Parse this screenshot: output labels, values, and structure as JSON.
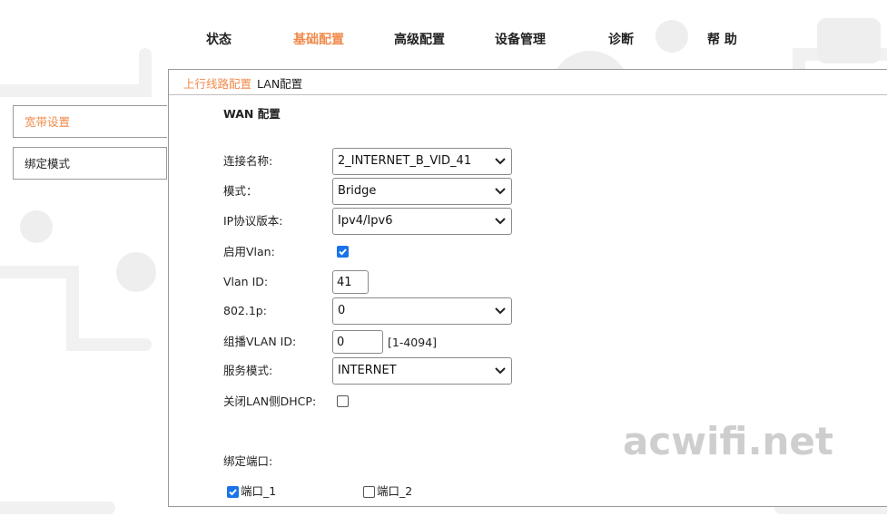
{
  "nav": {
    "items": [
      {
        "label": "状态",
        "active": false
      },
      {
        "label": "基础配置",
        "active": true
      },
      {
        "label": "高级配置",
        "active": false
      },
      {
        "label": "设备管理",
        "active": false
      },
      {
        "label": "诊断",
        "active": false
      },
      {
        "label": "帮 助",
        "active": false
      }
    ]
  },
  "sidebar": {
    "items": [
      {
        "label": "宽带设置",
        "active": true
      },
      {
        "label": "绑定模式",
        "active": false
      }
    ]
  },
  "breadcrumb": {
    "items": [
      "上行线路配置",
      "LAN配置"
    ]
  },
  "section_title": "WAN 配置",
  "form": {
    "connection_name": {
      "label": "连接名称:",
      "value": "2_INTERNET_B_VID_41"
    },
    "mode": {
      "label": "模式：",
      "value": "Bridge"
    },
    "ip_version": {
      "label": "IP协议版本:",
      "value": "Ipv4/Ipv6"
    },
    "enable_vlan": {
      "label": "启用Vlan:",
      "checked": true
    },
    "vlan_id": {
      "label": "Vlan ID:",
      "value": "41"
    },
    "dot1p": {
      "label": "802.1p:",
      "value": "0"
    },
    "multicast_vlan": {
      "label": "组播VLAN ID:",
      "value": "0",
      "hint": "[1-4094]"
    },
    "service_mode": {
      "label": "服务模式:",
      "value": "INTERNET"
    },
    "disable_lan_dhcp": {
      "label": "关闭LAN侧DHCP:",
      "checked": false
    },
    "bind_ports": {
      "label": "绑定端口:",
      "ports": [
        {
          "label": "端口_1",
          "checked": true
        },
        {
          "label": "端口_2",
          "checked": false
        }
      ]
    }
  },
  "watermark": "acwifi.net",
  "colors": {
    "accent": "#f08a4b",
    "checkbox": "#1a73e8"
  }
}
